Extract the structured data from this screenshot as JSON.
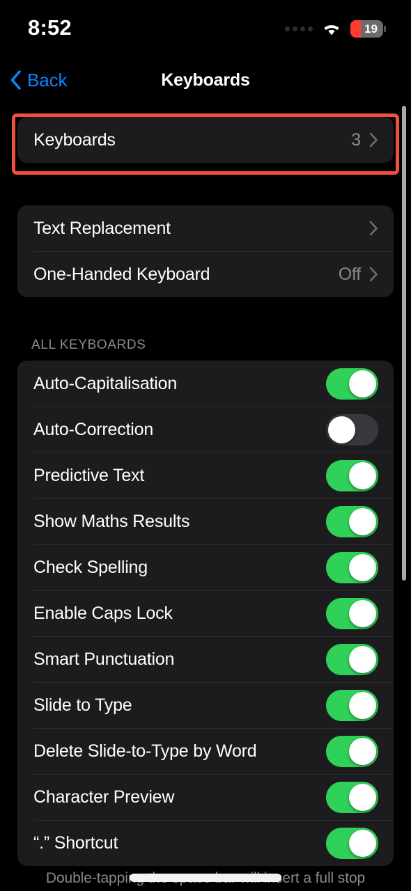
{
  "status_bar": {
    "time": "8:52",
    "battery_level": "19",
    "battery_color": "#ff3b30",
    "signal_icon": "cellular-dots-icon",
    "wifi_icon": "wifi-icon",
    "battery_icon": "battery-icon"
  },
  "nav": {
    "back_label": "Back",
    "back_icon": "chevron-left-icon",
    "title": "Keyboards",
    "accent_color": "#0a84ff"
  },
  "sections": {
    "keyboards_card": {
      "rows": [
        {
          "label": "Keyboards",
          "value": "3",
          "accessory": "chevron-right-icon"
        }
      ]
    },
    "text_card": {
      "rows": [
        {
          "label": "Text Replacement",
          "value": "",
          "accessory": "chevron-right-icon"
        },
        {
          "label": "One-Handed Keyboard",
          "value": "Off",
          "accessory": "chevron-right-icon"
        }
      ]
    },
    "all_keyboards": {
      "header": "ALL KEYBOARDS",
      "rows": [
        {
          "label": "Auto-Capitalisation",
          "state": "on"
        },
        {
          "label": "Auto-Correction",
          "state": "off"
        },
        {
          "label": "Predictive Text",
          "state": "on"
        },
        {
          "label": "Show Maths Results",
          "state": "on"
        },
        {
          "label": "Check Spelling",
          "state": "on"
        },
        {
          "label": "Enable Caps Lock",
          "state": "on"
        },
        {
          "label": "Smart Punctuation",
          "state": "on"
        },
        {
          "label": "Slide to Type",
          "state": "on"
        },
        {
          "label": "Delete Slide-to-Type by Word",
          "state": "on"
        },
        {
          "label": "Character Preview",
          "state": "on"
        },
        {
          "label": "“.” Shortcut",
          "state": "on"
        }
      ],
      "footer": "Double-tapping the space bar will insert a full stop"
    }
  },
  "highlight": {
    "target": "Keyboards",
    "color": "#f0503c"
  },
  "theme": {
    "background": "#000000",
    "card_background": "#1c1c1e",
    "separator": "#2c2c2e",
    "secondary_text": "#8a8a8e",
    "toggle_on": "#30d158",
    "toggle_off": "#39393d"
  }
}
